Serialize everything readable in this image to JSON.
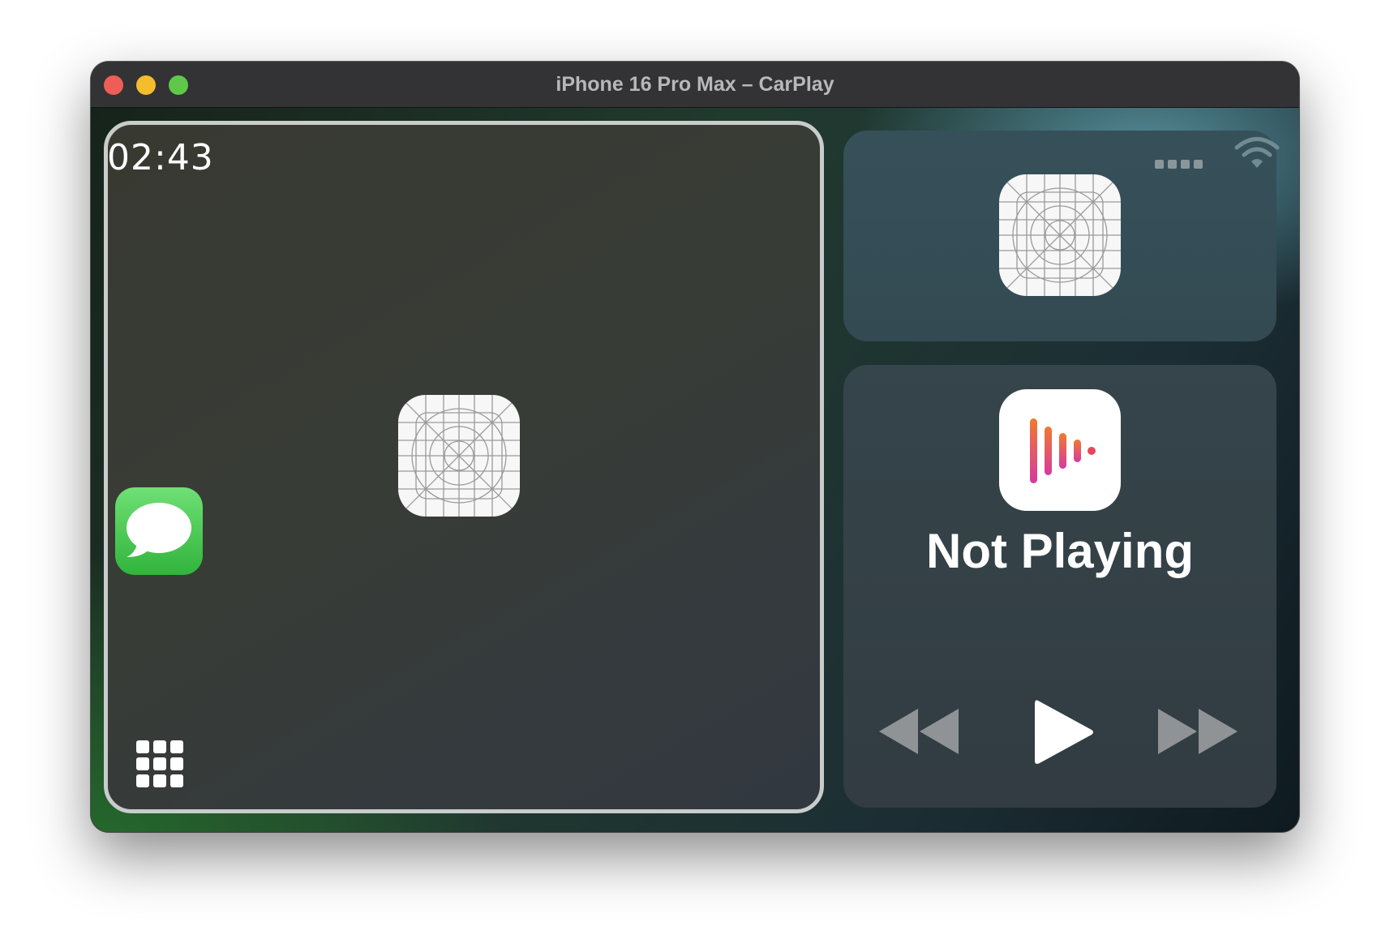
{
  "window": {
    "title": "iPhone 16 Pro Max – CarPlay"
  },
  "carplay": {
    "clock": "02:43",
    "apps": {
      "messages": "messages-app",
      "placeholder_center": "app-placeholder-icon",
      "placeholder_top_right": "app-placeholder-icon"
    },
    "now_playing": {
      "status": "Not Playing",
      "app_icon": "podcasts-icon"
    },
    "controls": {
      "rewind": "rewind-icon",
      "play": "play-icon",
      "fast_forward": "fast-forward-icon"
    },
    "status_bar": {
      "signal": "cellular-dots-icon",
      "wifi": "wifi-icon"
    }
  },
  "colors": {
    "traffic_close": "#ee5e57",
    "traffic_minimize": "#f3bd2e",
    "traffic_maximize": "#5fc84b",
    "messages_green": "#3ec047",
    "podcasts_gradient_top": "#f07a2e",
    "podcasts_gradient_bottom": "#d63aa0"
  }
}
